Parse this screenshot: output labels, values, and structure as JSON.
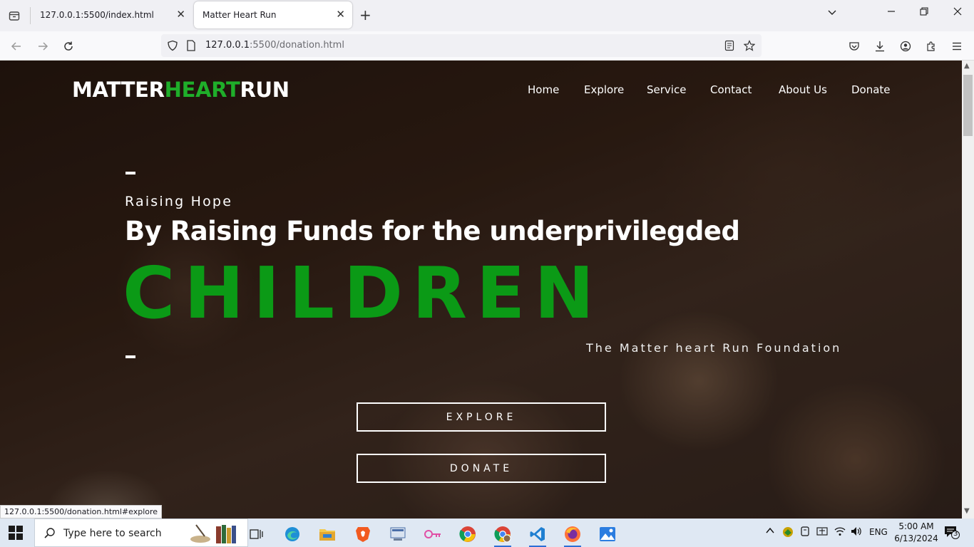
{
  "browser": {
    "tabs": [
      {
        "title": "127.0.0.1:5500/index.html",
        "active": false
      },
      {
        "title": "Matter Heart Run",
        "active": true
      }
    ],
    "url_host": "127.0.0.1",
    "url_path": ":5500/donation.html",
    "status_link": "127.0.0.1:5500/donation.html#explore"
  },
  "site": {
    "logo": {
      "part1": "MATTER",
      "part2": "HEART",
      "part3": "RUN"
    },
    "menu": [
      "Home",
      "Explore",
      "Service",
      "Contact",
      "About Us",
      "Donate"
    ],
    "hero": {
      "eyebrow": "Raising Hope",
      "headline": "By Raising Funds for the underprivilegded",
      "big_word": "CHILDREN",
      "foundation": "The Matter heart Run Foundation",
      "explore_label": "EXPLORE",
      "donate_label": "DONATE"
    }
  },
  "taskbar": {
    "search_placeholder": "Type here to search",
    "language": "ENG",
    "time": "5:00 AM",
    "date": "6/13/2024",
    "notification_count": "3"
  },
  "colors": {
    "brand_green": "#1fae2a",
    "hero_green": "#0b9a16"
  }
}
